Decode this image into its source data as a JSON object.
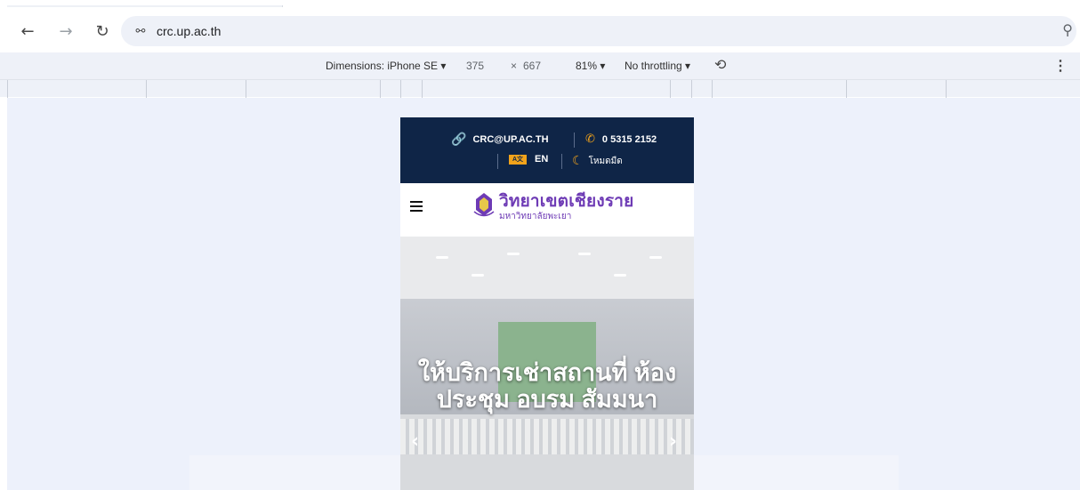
{
  "browser": {
    "url": "crc.up.ac.th",
    "icons": {
      "back": "arrow-left-icon",
      "forward": "arrow-right-icon",
      "reload": "reload-icon",
      "site_info": "tune-icon",
      "zoom": "zoom-out-icon"
    }
  },
  "device_toolbar": {
    "dimensions_label": "Dimensions: iPhone SE",
    "width": "375",
    "times": "×",
    "height": "667",
    "zoom": "81%",
    "throttling": "No throttling",
    "icons": {
      "rotate": "rotate-icon",
      "more": "more-vert-icon"
    }
  },
  "site": {
    "contact": {
      "email": "CRC@UP.AC.TH",
      "phone": "0 5315 2152",
      "language": "EN",
      "dark_mode": "โหมดมืด"
    },
    "logo": {
      "title": "วิทยาเขตเชียงราย",
      "subtitle": "มหาวิทยาลัยพะเยา"
    },
    "hero": {
      "title": "ให้บริการเช่าสถานที่ ห้องประชุม อบรม สัมมนา"
    }
  },
  "colors": {
    "contact_bar_bg": "#0f2547",
    "accent": "#f2a31b",
    "logo_purple": "#6e3bb5"
  }
}
